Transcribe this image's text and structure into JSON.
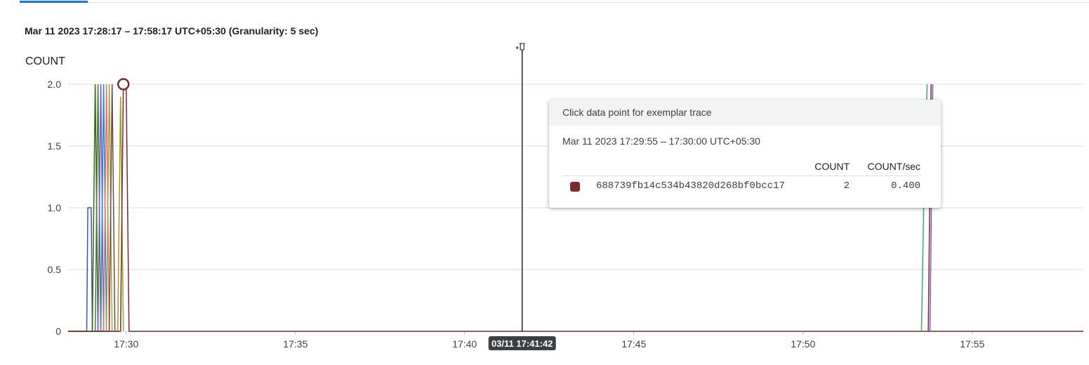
{
  "header": {
    "range_title": "Mar 11 2023 17:28:17 – 17:58:17 UTC+05:30 (Granularity: 5 sec)"
  },
  "chart_data": {
    "type": "line",
    "ylabel": "COUNT",
    "ylim": [
      0,
      2.0
    ],
    "y_ticks": [
      "0",
      "0.5",
      "1.0",
      "1.5",
      "2.0"
    ],
    "x_ticks": [
      "17:30",
      "17:35",
      "17:40",
      "17:45",
      "17:50",
      "17:55"
    ],
    "xlim": [
      "17:28:17",
      "17:58:17"
    ],
    "grid": true,
    "series": [
      {
        "color": "#3f51b5",
        "points": [
          [
            "17:28:17",
            0
          ],
          [
            "17:28:50",
            0
          ],
          [
            "17:28:52",
            1.0
          ],
          [
            "17:28:58",
            1.0
          ],
          [
            "17:29:00",
            0
          ]
        ]
      },
      {
        "color": "#33691e",
        "points": [
          [
            "17:28:17",
            0
          ],
          [
            "17:29:00",
            0
          ],
          [
            "17:29:05",
            2.0
          ],
          [
            "17:29:10",
            0
          ]
        ]
      },
      {
        "color": "#4e7c2b",
        "points": [
          [
            "17:28:17",
            0
          ],
          [
            "17:29:05",
            0
          ],
          [
            "17:29:10",
            2.0
          ],
          [
            "17:29:15",
            0
          ]
        ]
      },
      {
        "color": "#7e57c2",
        "points": [
          [
            "17:28:17",
            0
          ],
          [
            "17:29:10",
            0
          ],
          [
            "17:29:15",
            2.0
          ],
          [
            "17:29:20",
            0
          ]
        ]
      },
      {
        "color": "#1e88e5",
        "points": [
          [
            "17:28:17",
            0
          ],
          [
            "17:29:15",
            0
          ],
          [
            "17:29:20",
            2.0
          ],
          [
            "17:29:25",
            0
          ]
        ]
      },
      {
        "color": "#e57373",
        "points": [
          [
            "17:28:17",
            0
          ],
          [
            "17:29:20",
            0
          ],
          [
            "17:29:25",
            2.0
          ],
          [
            "17:29:30",
            0
          ]
        ]
      },
      {
        "color": "#b0a040",
        "points": [
          [
            "17:28:17",
            0
          ],
          [
            "17:29:25",
            0
          ],
          [
            "17:29:30",
            2.0
          ],
          [
            "17:29:35",
            0
          ]
        ]
      },
      {
        "color": "#6d4c41",
        "points": [
          [
            "17:28:17",
            0
          ],
          [
            "17:29:30",
            0
          ],
          [
            "17:29:35",
            2.0
          ],
          [
            "17:29:40",
            0
          ]
        ]
      },
      {
        "color": "#9e9d24",
        "points": [
          [
            "17:28:17",
            0
          ],
          [
            "17:29:45",
            0
          ],
          [
            "17:29:50",
            1.9
          ],
          [
            "17:29:55",
            0
          ]
        ]
      },
      {
        "color": "#7b2b2b",
        "points": [
          [
            "17:28:17",
            0
          ],
          [
            "17:29:50",
            0
          ],
          [
            "17:29:55",
            2.0
          ],
          [
            "17:30:00",
            2.0
          ],
          [
            "17:30:05",
            0
          ],
          [
            "17:58:17",
            0
          ]
        ]
      },
      {
        "color": "#3fa96a",
        "points": [
          [
            "17:53:30",
            0
          ],
          [
            "17:53:35",
            1.3
          ],
          [
            "17:53:40",
            2.0
          ]
        ]
      },
      {
        "color": "#7b2b2b",
        "points": [
          [
            "17:53:42",
            0
          ],
          [
            "17:53:47",
            2.0
          ]
        ]
      },
      {
        "color": "#7e57c2",
        "points": [
          [
            "17:53:45",
            0
          ],
          [
            "17:53:50",
            2.0
          ]
        ]
      }
    ],
    "highlight_point": {
      "x": "17:29:55",
      "y": 2.0,
      "color": "#7b2b2b"
    },
    "pin": {
      "x": "17:41:42",
      "label": "03/11 17:41:42"
    }
  },
  "tooltip": {
    "header": "Click data point for exemplar trace",
    "interval": "Mar 11 2023 17:29:55 – 17:30:00 UTC+05:30",
    "columns": [
      "COUNT",
      "COUNT/sec"
    ],
    "row": {
      "color": "#7b2b2b",
      "series": "688739fb14c534b43820d268bf0bcc17",
      "count": "2",
      "rate": "0.400"
    }
  }
}
